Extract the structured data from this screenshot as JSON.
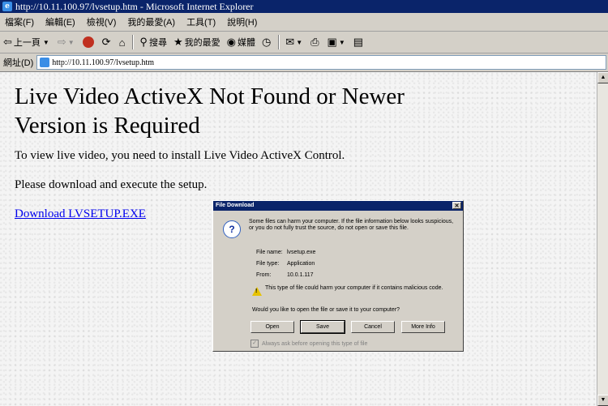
{
  "window": {
    "title": "http://10.11.100.97/lvsetup.htm - Microsoft Internet Explorer"
  },
  "menu": [
    "檔案(F)",
    "編輯(E)",
    "檢視(V)",
    "我的最愛(A)",
    "工具(T)",
    "說明(H)"
  ],
  "toolbar": {
    "back_label": "上一頁",
    "search_label": "搜尋",
    "favorites_label": "我的最愛",
    "media_label": "媒體"
  },
  "address": {
    "label": "網址(D)",
    "url": "http://10.11.100.97/lvsetup.htm"
  },
  "page": {
    "heading": "Live Video ActiveX Not Found or Newer Version is Required",
    "para1": "To view live video, you need to install Live Video ActiveX Control.",
    "para2": "Please download and execute the setup.",
    "link": "Download LVSETUP.EXE"
  },
  "dialog": {
    "title": "File Download",
    "warning": "Some files can harm your computer. If the file information below looks suspicious, or you do not fully trust the source, do not open or save this file.",
    "file_name_label": "File name:",
    "file_name": "lvsetup.exe",
    "file_type_label": "File type:",
    "file_type": "Application",
    "from_label": "From:",
    "from": "10.0.1.117",
    "harm_text": "This type of file could harm your computer if it contains malicious code.",
    "question": "Would you like to open the file or save it to your computer?",
    "buttons": {
      "open": "Open",
      "save": "Save",
      "cancel": "Cancel",
      "more_info": "More Info"
    },
    "checkbox_label": "Always ask before opening this type of file"
  }
}
